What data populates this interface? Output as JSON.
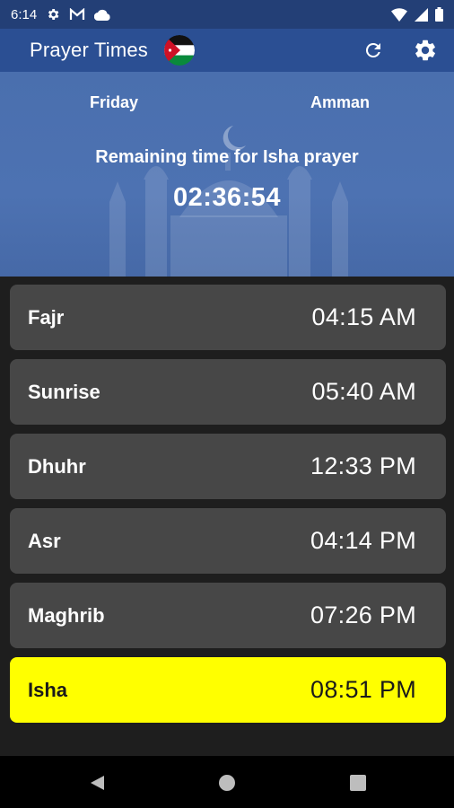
{
  "status_bar": {
    "time": "6:14",
    "icons": [
      "gear-icon",
      "gmail-icon",
      "cloud-icon",
      "wifi-icon",
      "signal-icon",
      "battery-icon"
    ]
  },
  "app_bar": {
    "title": "Prayer Times",
    "flag": "jordan-flag-icon",
    "actions": [
      "refresh-icon",
      "settings-icon"
    ]
  },
  "hero": {
    "day": "Friday",
    "city": "Amman",
    "remaining_label": "Remaining time for Isha prayer",
    "countdown": "02:36:54"
  },
  "prayers": [
    {
      "name": "Fajr",
      "time": "04:15 AM",
      "active": false
    },
    {
      "name": "Sunrise",
      "time": "05:40 AM",
      "active": false
    },
    {
      "name": "Dhuhr",
      "time": "12:33 PM",
      "active": false
    },
    {
      "name": "Asr",
      "time": "04:14 PM",
      "active": false
    },
    {
      "name": "Maghrib",
      "time": "07:26 PM",
      "active": false
    },
    {
      "name": "Isha",
      "time": "08:51 PM",
      "active": true
    }
  ],
  "colors": {
    "status_bar": "#233f76",
    "app_bar": "#2b4f93",
    "hero": "#4d72b2",
    "row": "#474747",
    "active_row": "#ffff00",
    "background": "#1e1e1e"
  },
  "nav_bar": {
    "buttons": [
      "back-icon",
      "home-icon",
      "recents-icon"
    ]
  }
}
